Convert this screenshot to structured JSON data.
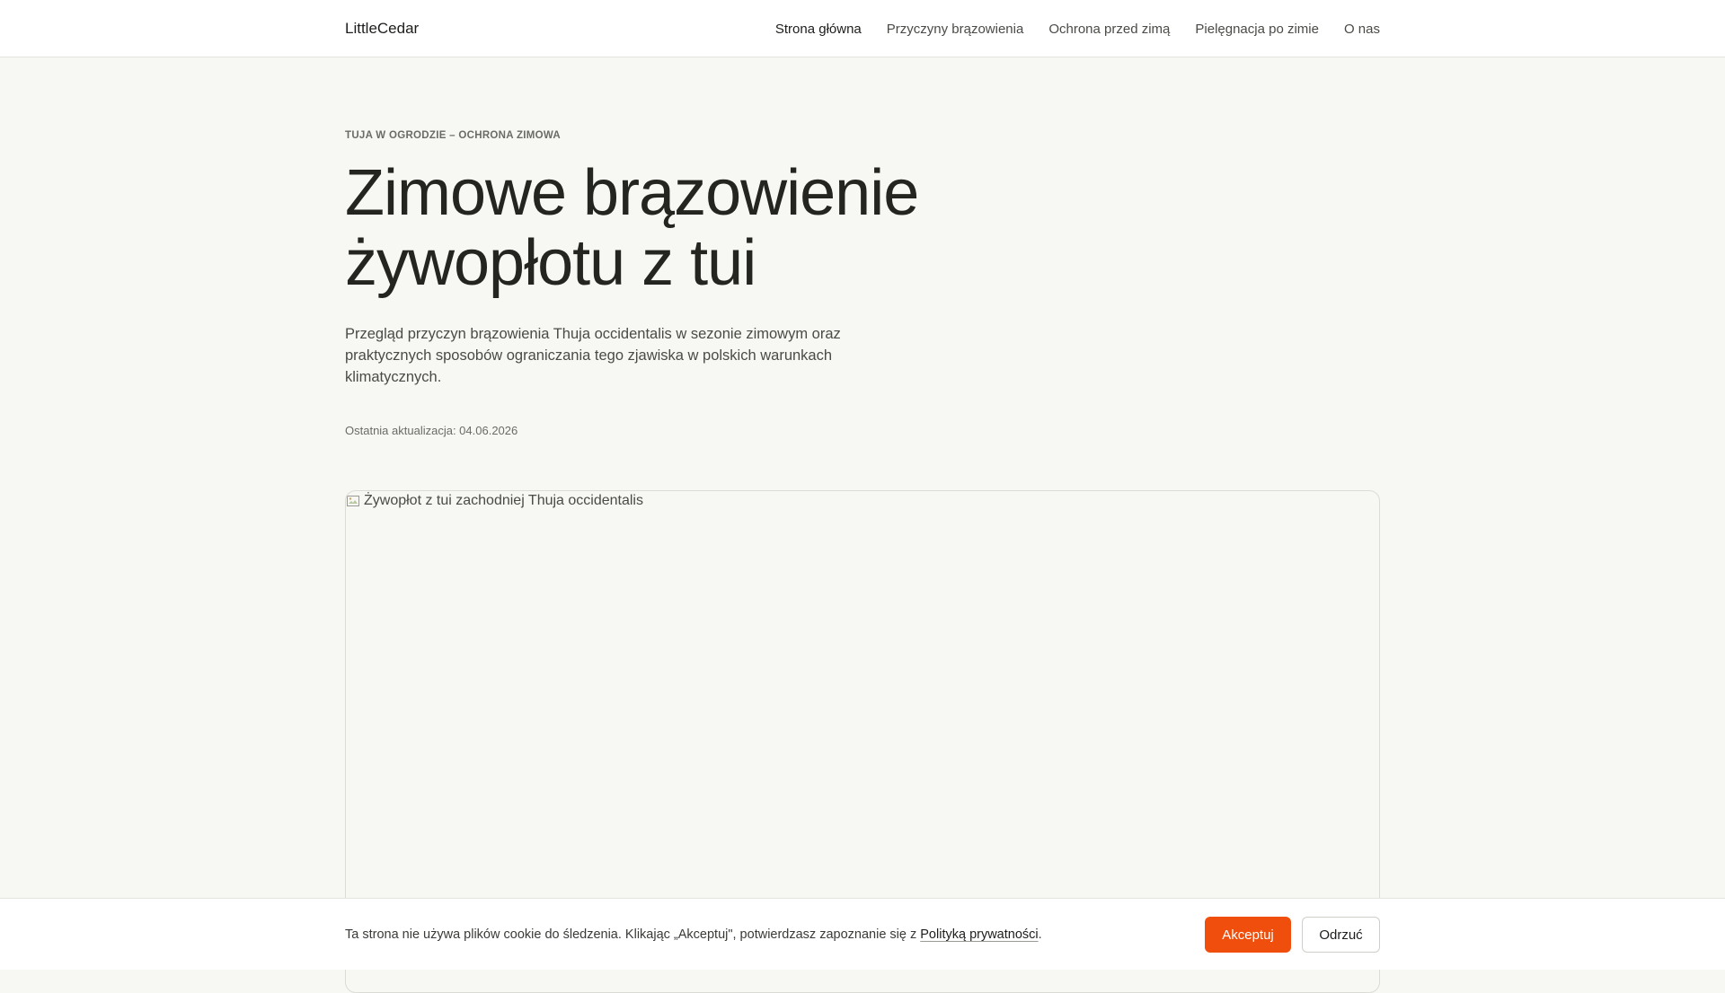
{
  "header": {
    "brand": "LittleCedar",
    "nav": [
      {
        "label": "Strona główna",
        "active": true
      },
      {
        "label": "Przyczyny brązowienia",
        "active": false
      },
      {
        "label": "Ochrona przed zimą",
        "active": false
      },
      {
        "label": "Pielęgnacja po zimie",
        "active": false
      },
      {
        "label": "O nas",
        "active": false
      }
    ]
  },
  "hero": {
    "eyebrow": "TUJA W OGRODZIE – OCHRONA ZIMOWA",
    "title": "Zimowe brązowienie żywopłotu z tui",
    "lead": "Przegląd przyczyn brązowienia Thuja occidentalis w sezonie zimowym oraz praktycznych sposobów ograniczania tego zjawiska w polskich warunkach klimatycznych.",
    "updated": "Ostatnia aktualizacja: 04.06.2026"
  },
  "figure": {
    "alt": "Żywopłot z tui zachodniej Thuja occidentalis",
    "icon": "broken-image-icon"
  },
  "cookie": {
    "text_before": "Ta strona nie używa plików cookie do śledzenia. Klikając „Akceptuj\", potwierdzasz zapoznanie się z ",
    "link": "Polityką prywatności",
    "text_after": ".",
    "accept_label": "Akceptuj",
    "reject_label": "Odrzuć"
  },
  "colors": {
    "accent": "#f04e0c",
    "background": "#f7f7f4"
  }
}
